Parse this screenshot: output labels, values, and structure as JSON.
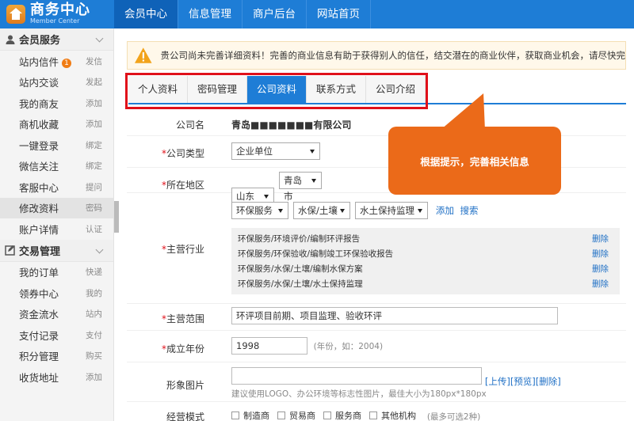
{
  "app": {
    "title": "商务中心",
    "subtitle": "Member Center"
  },
  "topnav": [
    "会员中心",
    "信息管理",
    "商户后台",
    "网站首页"
  ],
  "sidebar": {
    "sections": [
      {
        "title": "会员服务",
        "items": [
          {
            "label": "站内信件",
            "badge": "1",
            "extra": "发信"
          },
          {
            "label": "站内交谈",
            "extra": "发起"
          },
          {
            "label": "我的商友",
            "extra": "添加"
          },
          {
            "label": "商机收藏",
            "extra": "添加"
          },
          {
            "label": "一键登录",
            "extra": "绑定"
          },
          {
            "label": "微信关注",
            "extra": "绑定"
          },
          {
            "label": "客服中心",
            "extra": "提问"
          },
          {
            "label": "修改资料",
            "extra": "密码"
          },
          {
            "label": "账户详情",
            "extra": "认证"
          }
        ]
      },
      {
        "title": "交易管理",
        "items": [
          {
            "label": "我的订单",
            "extra": "快递"
          },
          {
            "label": "领券中心",
            "extra": "我的"
          },
          {
            "label": "资金流水",
            "extra": "站内"
          },
          {
            "label": "支付记录",
            "extra": "支付"
          },
          {
            "label": "积分管理",
            "extra": "购买"
          },
          {
            "label": "收货地址",
            "extra": "添加"
          }
        ]
      }
    ]
  },
  "notice": "贵公司尚未完善详细资料！完善的商业信息有助于获得别人的信任，结交潜在的商业伙伴，获取商业机会，请尽快完善",
  "tabs": [
    "个人资料",
    "密码管理",
    "公司资料",
    "联系方式",
    "公司介绍"
  ],
  "callout": "根据提示，完善相关信息",
  "form": {
    "company_label": "公司名",
    "company_value": "青岛■■■■■■■有限公司",
    "type_label": "公司类型",
    "type_value": "企业单位",
    "region_label": "所在地区",
    "region_province": "山东",
    "region_city": "青岛市",
    "industry_label": "主营行业",
    "industry_selects": [
      "环保服务",
      "水保/土壤",
      "水土保持监理"
    ],
    "industry_add": "添加",
    "industry_search": "搜索",
    "industry_list": [
      "环保服务/环境评价/编制环评报告",
      "环保服务/环保验收/编制竣工环保验收报告",
      "环保服务/水保/土壤/编制水保方案",
      "环保服务/水保/土壤/水土保持监理"
    ],
    "delete_label": "删除",
    "scope_label": "主营范围",
    "scope_value": "环评项目前期、项目监理、验收环评",
    "year_label": "成立年份",
    "year_value": "1998",
    "year_hint": "(年份，如：2004)",
    "image_label": "形象图片",
    "image_actions": [
      "[上传]",
      "[预览]",
      "[删除]"
    ],
    "image_hint": "建议使用LOGO、办公环境等标志性图片，最佳大小为180px*180px",
    "mode_label": "经营模式",
    "mode_options": [
      "制造商",
      "贸易商",
      "服务商",
      "其他机构"
    ],
    "mode_hint": "(最多可选2种)"
  }
}
